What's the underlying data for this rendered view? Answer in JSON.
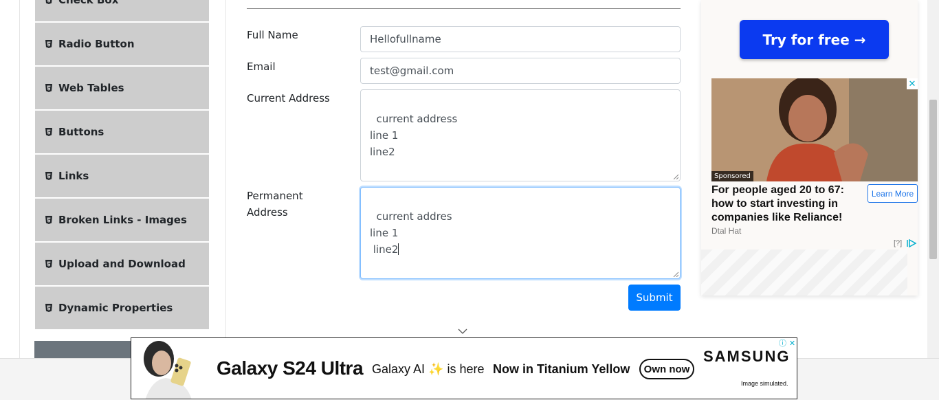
{
  "sidebar": {
    "items": [
      {
        "label": "Check Box"
      },
      {
        "label": "Radio Button"
      },
      {
        "label": "Web Tables"
      },
      {
        "label": "Buttons"
      },
      {
        "label": "Links"
      },
      {
        "label": "Broken Links - Images"
      },
      {
        "label": "Upload and Download"
      },
      {
        "label": "Dynamic Properties"
      }
    ]
  },
  "form": {
    "full_name_label": "Full Name",
    "full_name_value": "Hellofullname",
    "email_label": "Email",
    "email_value": "test@gmail.com",
    "current_address_label": "Current Address",
    "current_address_value": "current address\nline 1\nline2",
    "permanent_address_label_1": "Permanent",
    "permanent_address_label_2": "Address",
    "permanent_address_value": "current addres\nline 1\n line2",
    "submit_label": "Submit"
  },
  "right_ad": {
    "cta": "Try for free →",
    "sponsored": "Sponsored",
    "headline": "For people aged 20 to 67: how to start investing in companies like Reliance!",
    "learn_more": "Learn More",
    "source": "Dtal Hat",
    "info": "[?]"
  },
  "bottom_banner": {
    "model": "Galaxy S24 Ultra",
    "ai_text": "Galaxy AI ✨ is here",
    "promo": "Now in Titanium Yellow",
    "cta": "Own now",
    "brand": "SAMSUNG",
    "disclaimer": "Image simulated."
  },
  "colors": {
    "sidebar_bg": "#cdcdcd",
    "submit_bg": "#007bff",
    "try_btn_bg": "#0b3af0",
    "learn_more": "#1a73e8"
  }
}
